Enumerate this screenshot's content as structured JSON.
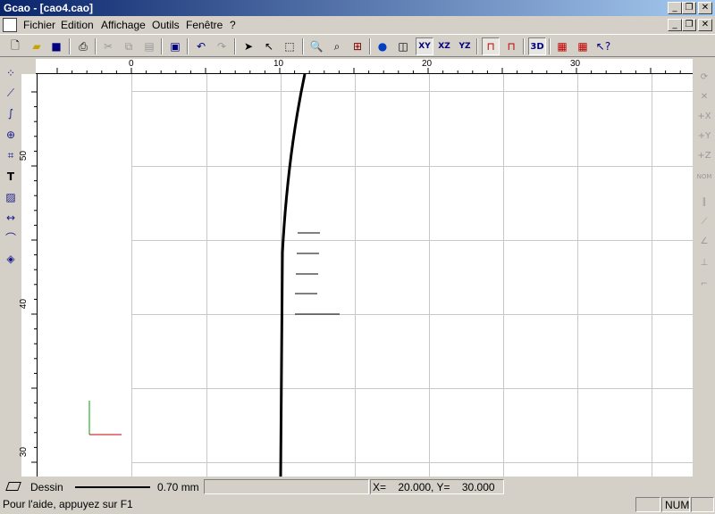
{
  "window": {
    "title": "Gcao - [cao4.cao]",
    "minimize": "_",
    "restore": "❐",
    "close": "✕"
  },
  "menu": [
    "Fichier",
    "Edition",
    "Affichage",
    "Outils",
    "Fenêtre",
    "?"
  ],
  "toolbar": {
    "xy": "XY",
    "xz": "XZ",
    "yz": "YZ",
    "view3d": "3D"
  },
  "ruler": {
    "h_labels": [
      "0",
      "10",
      "20",
      "30"
    ],
    "v_labels": [
      "50",
      "40",
      "30"
    ]
  },
  "right_toolbar": {
    "nom": "NOM"
  },
  "status": {
    "layer_name": "Dessin",
    "line_width": "0.70 mm",
    "coords": "X=    20.000, Y=    30.000",
    "help": "Pour l'aide, appuyez sur F1",
    "num": "NUM"
  },
  "colors": {
    "title_start": "#0a246a",
    "title_end": "#a6caf0",
    "axis_x": "#c00000",
    "axis_y": "#00a000"
  }
}
